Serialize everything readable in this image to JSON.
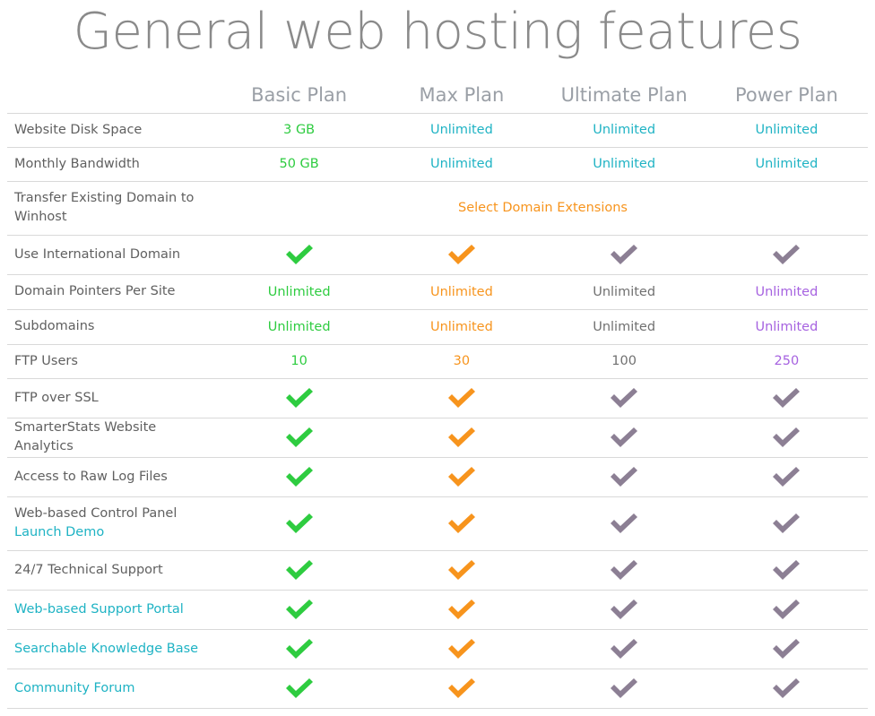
{
  "title": "General web hosting features",
  "colors": {
    "green": "#2ecc40",
    "orange": "#f7941d",
    "purple_gray": "#8c7f94",
    "teal": "#1fb3c4",
    "purple": "#a662e0"
  },
  "plans": [
    "Basic Plan",
    "Max Plan",
    "Ultimate Plan",
    "Power Plan"
  ],
  "rows": [
    {
      "feature": "Website Disk Space",
      "values": [
        "3 GB",
        "Unlimited",
        "Unlimited",
        "Unlimited"
      ]
    },
    {
      "feature": "Monthly Bandwidth",
      "values": [
        "50 GB",
        "Unlimited",
        "Unlimited",
        "Unlimited"
      ]
    },
    {
      "feature": "Transfer Existing Domain to Winhost",
      "span_value": "Select Domain Extensions"
    },
    {
      "feature": "Use International Domain",
      "values": [
        "check-icon",
        "check-icon",
        "check-icon",
        "check-icon"
      ]
    },
    {
      "feature": "Domain Pointers Per Site",
      "values": [
        "Unlimited",
        "Unlimited",
        "Unlimited",
        "Unlimited"
      ]
    },
    {
      "feature": "Subdomains",
      "values": [
        "Unlimited",
        "Unlimited",
        "Unlimited",
        "Unlimited"
      ]
    },
    {
      "feature": "FTP Users",
      "values": [
        "10",
        "30",
        "100",
        "250"
      ]
    },
    {
      "feature": "FTP over SSL",
      "values": [
        "check-icon",
        "check-icon",
        "check-icon",
        "check-icon"
      ]
    },
    {
      "feature": "SmarterStats Website Analytics",
      "values": [
        "check-icon",
        "check-icon",
        "check-icon",
        "check-icon"
      ]
    },
    {
      "feature": "Access to Raw Log Files",
      "values": [
        "check-icon",
        "check-icon",
        "check-icon",
        "check-icon"
      ]
    },
    {
      "feature": "Web-based Control Panel",
      "link": "Launch Demo",
      "values": [
        "check-icon",
        "check-icon",
        "check-icon",
        "check-icon"
      ]
    },
    {
      "feature": "24/7 Technical Support",
      "values": [
        "check-icon",
        "check-icon",
        "check-icon",
        "check-icon"
      ]
    },
    {
      "feature": "Web-based Support Portal",
      "is_link": true,
      "values": [
        "check-icon",
        "check-icon",
        "check-icon",
        "check-icon"
      ]
    },
    {
      "feature": "Searchable Knowledge Base",
      "is_link": true,
      "values": [
        "check-icon",
        "check-icon",
        "check-icon",
        "check-icon"
      ]
    },
    {
      "feature": "Community Forum",
      "is_link": true,
      "values": [
        "check-icon",
        "check-icon",
        "check-icon",
        "check-icon"
      ]
    }
  ]
}
